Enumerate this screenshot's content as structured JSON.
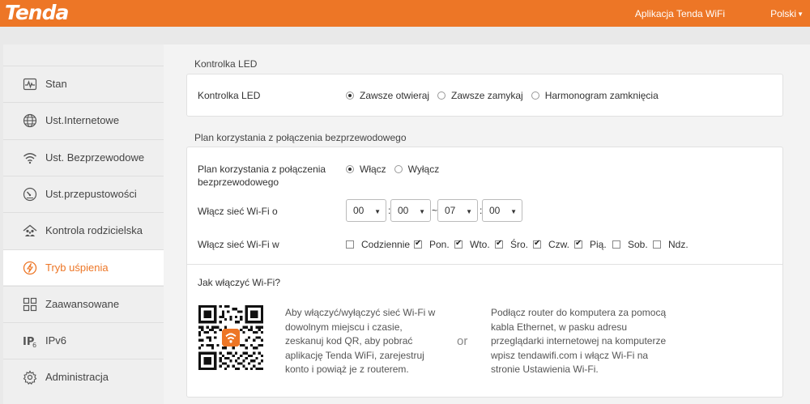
{
  "header": {
    "logo": "Tenda",
    "app_link": "Aplikacja Tenda WiFi",
    "language": "Polski",
    "accent_color": "#ed7626"
  },
  "sidebar": {
    "items": [
      {
        "label": "Stan",
        "icon": "status-icon"
      },
      {
        "label": "Ust.Internetowe",
        "icon": "globe-icon"
      },
      {
        "label": "Ust. Bezprzewodowe",
        "icon": "wifi-icon"
      },
      {
        "label": "Ust.przepustowości",
        "icon": "gauge-icon"
      },
      {
        "label": "Kontrola rodzicielska",
        "icon": "family-icon"
      },
      {
        "label": "Tryb uśpienia",
        "icon": "sleep-icon",
        "active": true
      },
      {
        "label": "Zaawansowane",
        "icon": "grid-icon"
      },
      {
        "label": "IPv6",
        "icon": "ipv6-icon"
      },
      {
        "label": "Administracja",
        "icon": "gear-icon"
      }
    ]
  },
  "led_section": {
    "title": "Kontrolka LED",
    "label": "Kontrolka LED",
    "options": [
      "Zawsze otwieraj",
      "Zawsze zamykaj",
      "Harmonogram zamknięcia"
    ],
    "selected": "Zawsze otwieraj"
  },
  "wifi_schedule_section": {
    "title": "Plan korzystania z połączenia bezprzewodowego",
    "enable_label": "Plan korzystania z połączenia bezprzewodowego",
    "enable_options": [
      "Włącz",
      "Wyłącz"
    ],
    "enable_selected": "Włącz",
    "time_label": "Włącz sieć Wi-Fi o",
    "start_hour": "00",
    "start_minute": "00",
    "end_hour": "07",
    "end_minute": "00",
    "time_sep": ":",
    "range_sep": "~",
    "days_label": "Włącz sieć Wi-Fi w",
    "days": [
      {
        "label": "Codziennie",
        "checked": false
      },
      {
        "label": "Pon.",
        "checked": true
      },
      {
        "label": "Wto.",
        "checked": true
      },
      {
        "label": "Śro.",
        "checked": true
      },
      {
        "label": "Czw.",
        "checked": true
      },
      {
        "label": "Pią.",
        "checked": true
      },
      {
        "label": "Sob.",
        "checked": false
      },
      {
        "label": "Ndz.",
        "checked": false
      }
    ]
  },
  "howto": {
    "title": "Jak włączyć Wi-Fi?",
    "app_text": "Aby włączyć/wyłączyć sieć Wi-Fi w dowolnym miejscu i czasie, zeskanuj kod QR, aby pobrać aplikację Tenda WiFi, zarejestruj konto i powiąż je z routerem.",
    "or": "or",
    "pc_text": "Podłącz router do komputera za pomocą kabla Ethernet, w pasku adresu przeglądarki internetowej na komputerze wpisz tendawifi.com i włącz Wi-Fi na stronie Ustawienia Wi-Fi."
  }
}
